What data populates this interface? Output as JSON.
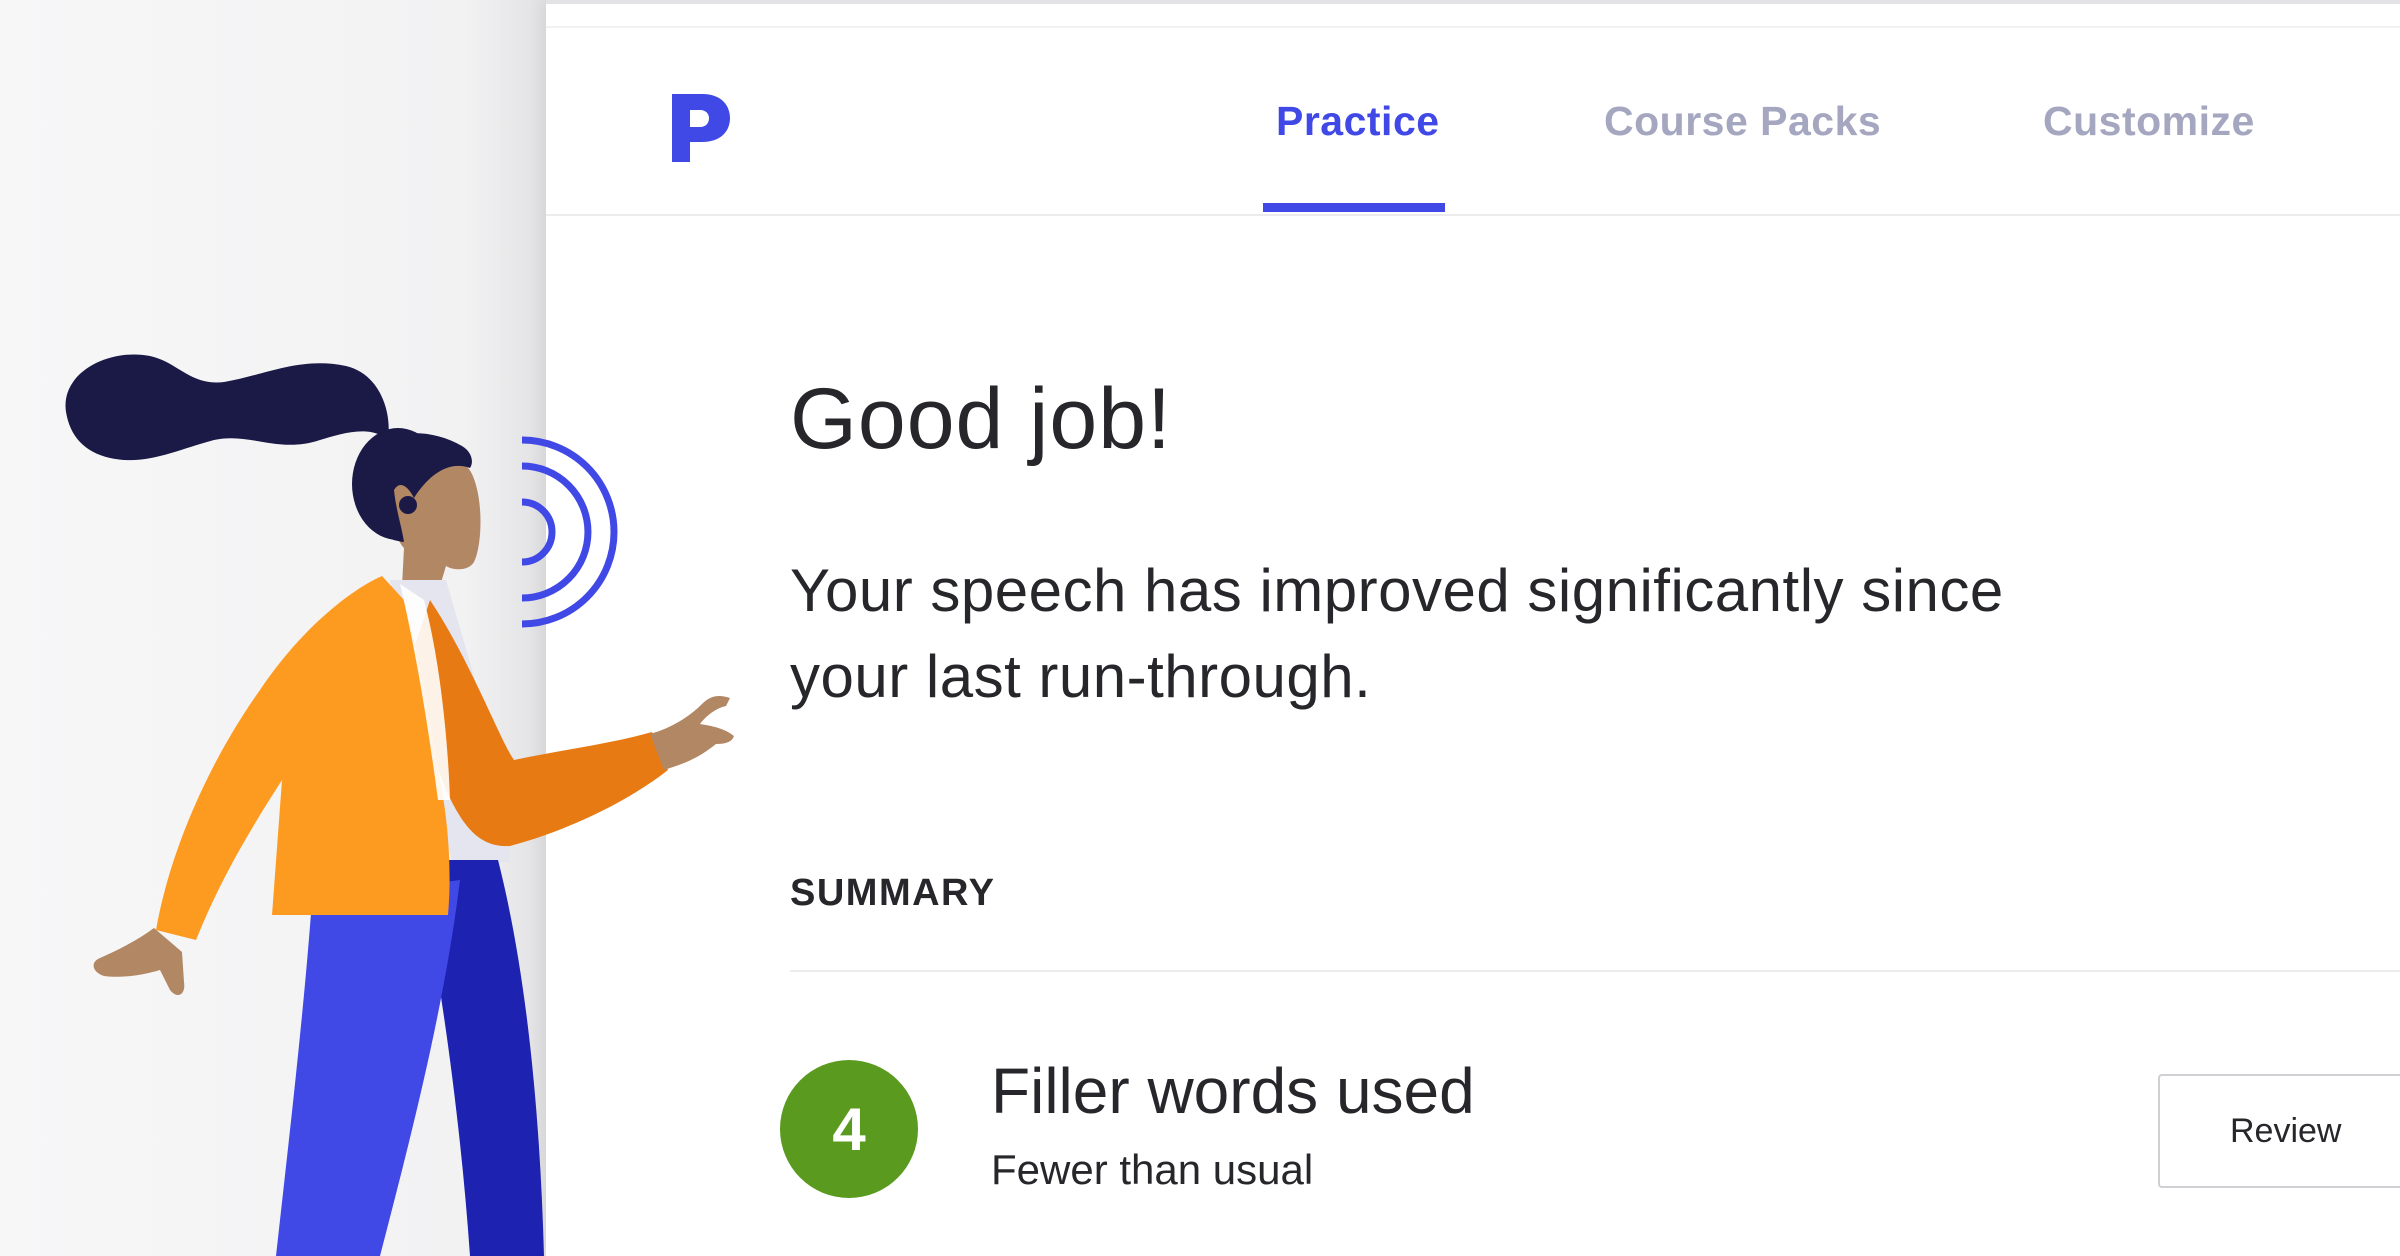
{
  "nav": {
    "logo_letter": "P",
    "tabs": [
      {
        "label": "Practice",
        "active": true
      },
      {
        "label": "Course Packs",
        "active": false
      },
      {
        "label": "Customize",
        "active": false
      }
    ]
  },
  "main": {
    "headline": "Good job!",
    "message": "Your speech has improved significantly since your last run-through."
  },
  "summary": {
    "title": "SUMMARY",
    "metrics": [
      {
        "value": "4",
        "title": "Filler words used",
        "subtitle": "Fewer than usual",
        "action_label": "Review"
      }
    ]
  },
  "colors": {
    "accent": "#4048e6",
    "inactive_tab": "#a5a6bf",
    "success": "#5a9b1f",
    "text": "#26262b"
  }
}
